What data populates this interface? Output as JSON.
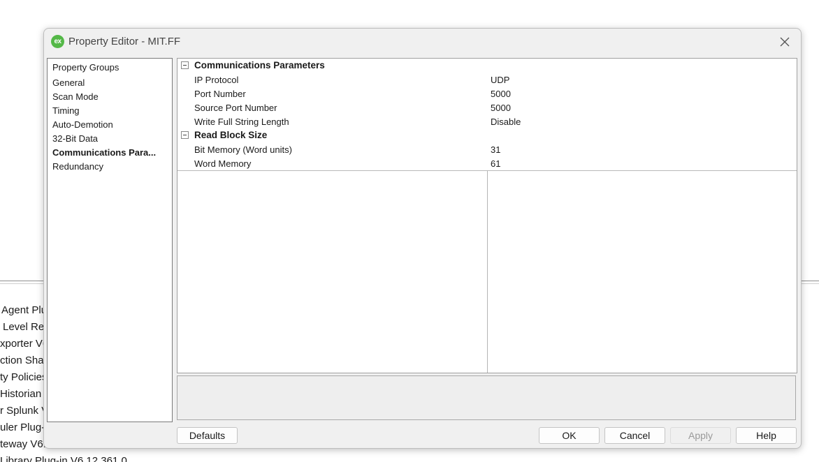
{
  "background": {
    "items": [
      "Agent Plu",
      "Level Rec",
      "xporter V6",
      "ction Shar",
      "ty Policies",
      "Historian",
      "r Splunk V",
      "uler Plug-",
      "teway V6.",
      "Library Plug-in V6.12.361.0"
    ]
  },
  "dialog": {
    "icon_text": "ex",
    "title": "Property Editor - MIT.FF",
    "close_icon": "close-icon",
    "groups_header": "Property Groups",
    "groups": [
      {
        "label": "General",
        "selected": false
      },
      {
        "label": "Scan Mode",
        "selected": false
      },
      {
        "label": "Timing",
        "selected": false
      },
      {
        "label": "Auto-Demotion",
        "selected": false
      },
      {
        "label": "32-Bit Data",
        "selected": false
      },
      {
        "label": "Communications Para...",
        "selected": true
      },
      {
        "label": "Redundancy",
        "selected": false
      }
    ],
    "grid": {
      "categories": [
        {
          "label": "Communications Parameters",
          "properties": [
            {
              "name": "IP Protocol",
              "value": "UDP"
            },
            {
              "name": "Port Number",
              "value": "5000"
            },
            {
              "name": "Source Port Number",
              "value": "5000"
            },
            {
              "name": "Write Full String Length",
              "value": "Disable"
            }
          ]
        },
        {
          "label": "Read Block Size",
          "properties": [
            {
              "name": "Bit Memory (Word units)",
              "value": "31"
            },
            {
              "name": "Word Memory",
              "value": "61"
            }
          ]
        }
      ]
    },
    "description": "",
    "buttons": {
      "defaults": "Defaults",
      "ok": "OK",
      "cancel": "Cancel",
      "apply": "Apply",
      "help": "Help"
    }
  }
}
